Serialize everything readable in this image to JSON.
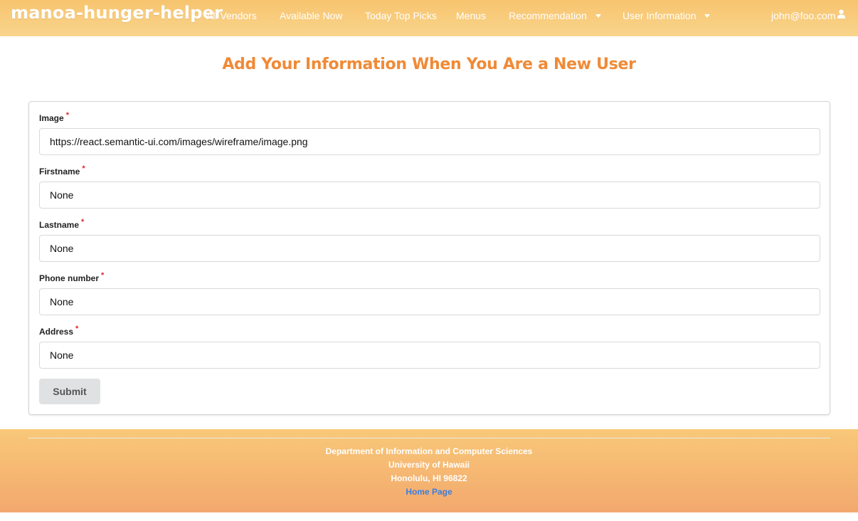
{
  "navbar": {
    "brand": "manoa-hunger-helper",
    "items": [
      {
        "label": "All Vendors"
      },
      {
        "label": "Available Now"
      },
      {
        "label": "Today Top Picks"
      },
      {
        "label": "Menus"
      },
      {
        "label": "Recommendation"
      },
      {
        "label": "User Information"
      }
    ],
    "user_email": "john@foo.com",
    "user_icon": "user-icon"
  },
  "page": {
    "title": "Add Your Information When You Are a New User"
  },
  "form": {
    "required_mark": "*",
    "fields": [
      {
        "label": "Image",
        "value": "https://react.semantic-ui.com/images/wireframe/image.png"
      },
      {
        "label": "Firstname",
        "value": "None"
      },
      {
        "label": "Lastname",
        "value": "None"
      },
      {
        "label": "Phone number",
        "value": "None"
      },
      {
        "label": "Address",
        "value": "None"
      }
    ],
    "submit_label": "Submit"
  },
  "footer": {
    "line1": "Department of Information and Computer Sciences",
    "line2": "University of Hawaii",
    "line3": "Honolulu, HI 96822",
    "link": "Home Page"
  },
  "colors": {
    "navbar": "#f7c46e",
    "title": "#f08a36",
    "required": "#db2828",
    "link": "#3b7ddd",
    "button": "#e0e1e2"
  }
}
